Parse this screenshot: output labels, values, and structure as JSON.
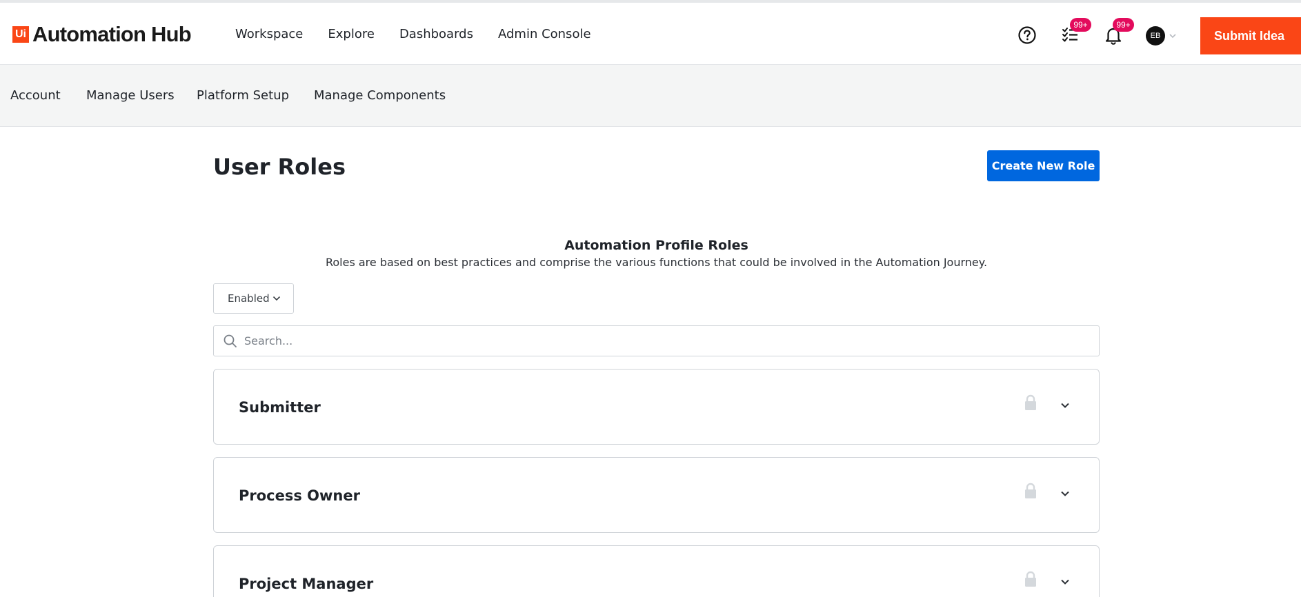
{
  "header": {
    "logo_mark": "Ui",
    "logo_text": "Automation Hub",
    "nav": [
      "Workspace",
      "Explore",
      "Dashboards",
      "Admin Console"
    ],
    "tasks_badge": "99+",
    "notifications_badge": "99+",
    "avatar_initials": "EB",
    "submit_label": "Submit Idea",
    "icons": [
      "help-icon",
      "task-list-icon",
      "bell-icon",
      "chevron-down-icon"
    ]
  },
  "subnav": {
    "items": [
      "Account",
      "Manage Users",
      "Platform Setup",
      "Manage Components"
    ]
  },
  "main": {
    "title": "User Roles",
    "create_button": "Create New Role",
    "section_title": "Automation Profile Roles",
    "section_desc": "Roles are based on best practices and comprise the various functions that could be involved in the Automation Journey.",
    "filter_value": "Enabled",
    "search_placeholder": "Search...",
    "roles": [
      {
        "name": "Submitter",
        "locked": true
      },
      {
        "name": "Process Owner",
        "locked": true
      },
      {
        "name": "Project Manager",
        "locked": true
      }
    ]
  },
  "colors": {
    "brand_orange": "#fa4616",
    "primary_blue": "#0067df",
    "badge_pink": "#e30b5c",
    "subnav_bg": "#f4f5f5"
  }
}
